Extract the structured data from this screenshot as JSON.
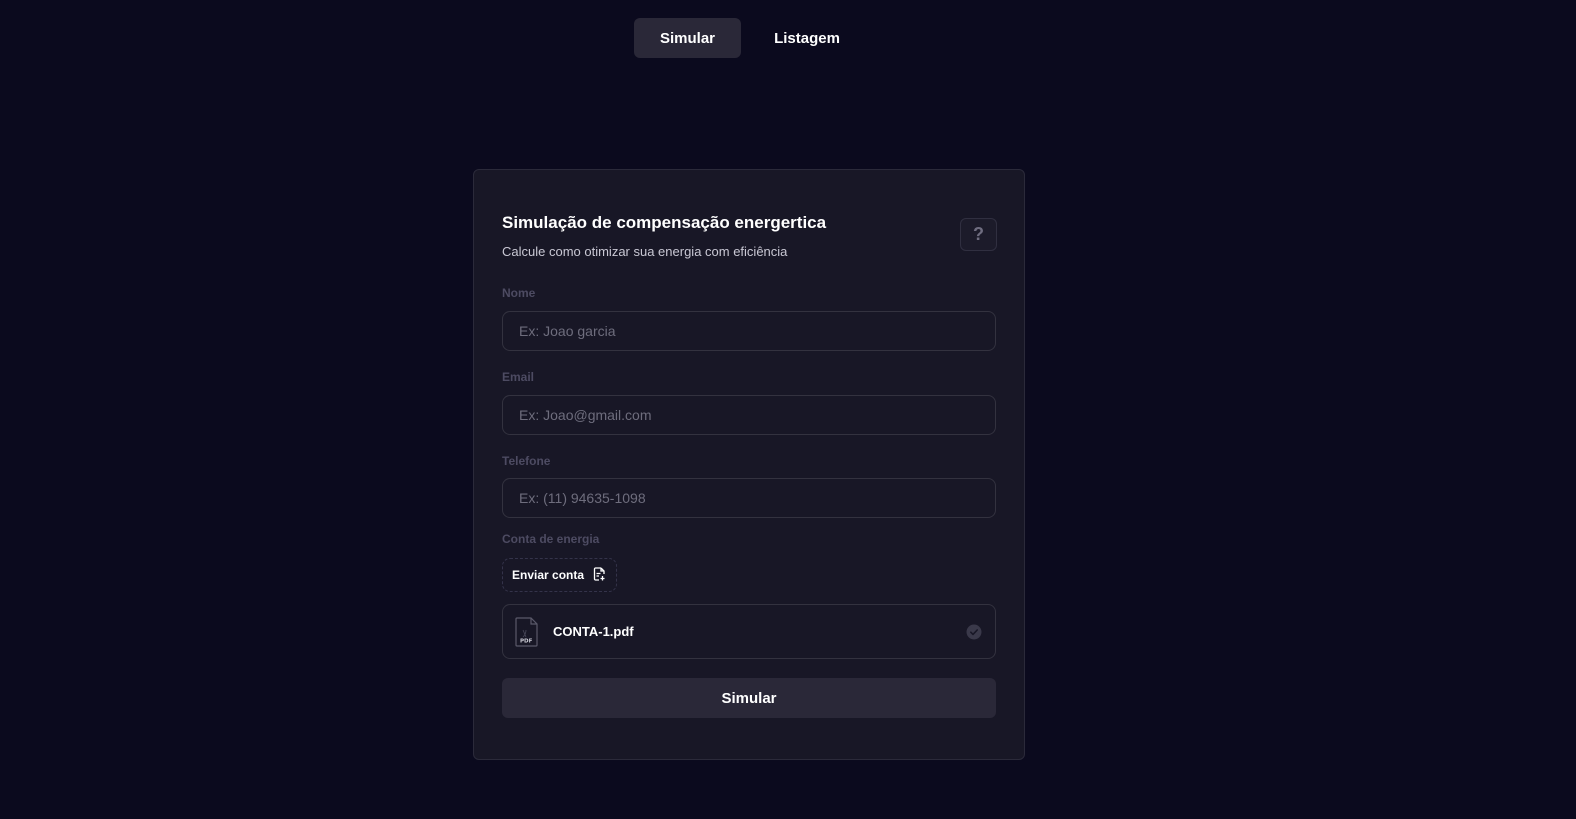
{
  "nav": {
    "tabs": [
      {
        "label": "Simular",
        "active": true
      },
      {
        "label": "Listagem",
        "active": false
      }
    ]
  },
  "form": {
    "title": "Simulação de compensação energertica",
    "subtitle": "Calcule como otimizar sua energia com eficiência",
    "help_label": "?",
    "fields": {
      "name": {
        "label": "Nome",
        "placeholder": "Ex: Joao garcia",
        "value": ""
      },
      "email": {
        "label": "Email",
        "placeholder": "Ex: Joao@gmail.com",
        "value": ""
      },
      "phone": {
        "label": "Telefone",
        "placeholder": "Ex: (11) 94635-1098",
        "value": ""
      }
    },
    "energy_bill": {
      "label": "Conta de energia",
      "upload_label": "Enviar conta",
      "file": {
        "name": "CONTA-1.pdf",
        "type_badge": "PDF"
      }
    },
    "submit_label": "Simular"
  },
  "colors": {
    "background": "#0b0a1e",
    "card": "#181726",
    "accent_button": "#2a2838",
    "label": "#4d4b62"
  },
  "icons": {
    "help": "question-mark-icon",
    "upload": "file-upload-icon",
    "file": "pdf-file-icon",
    "status": "check-circle-icon"
  }
}
